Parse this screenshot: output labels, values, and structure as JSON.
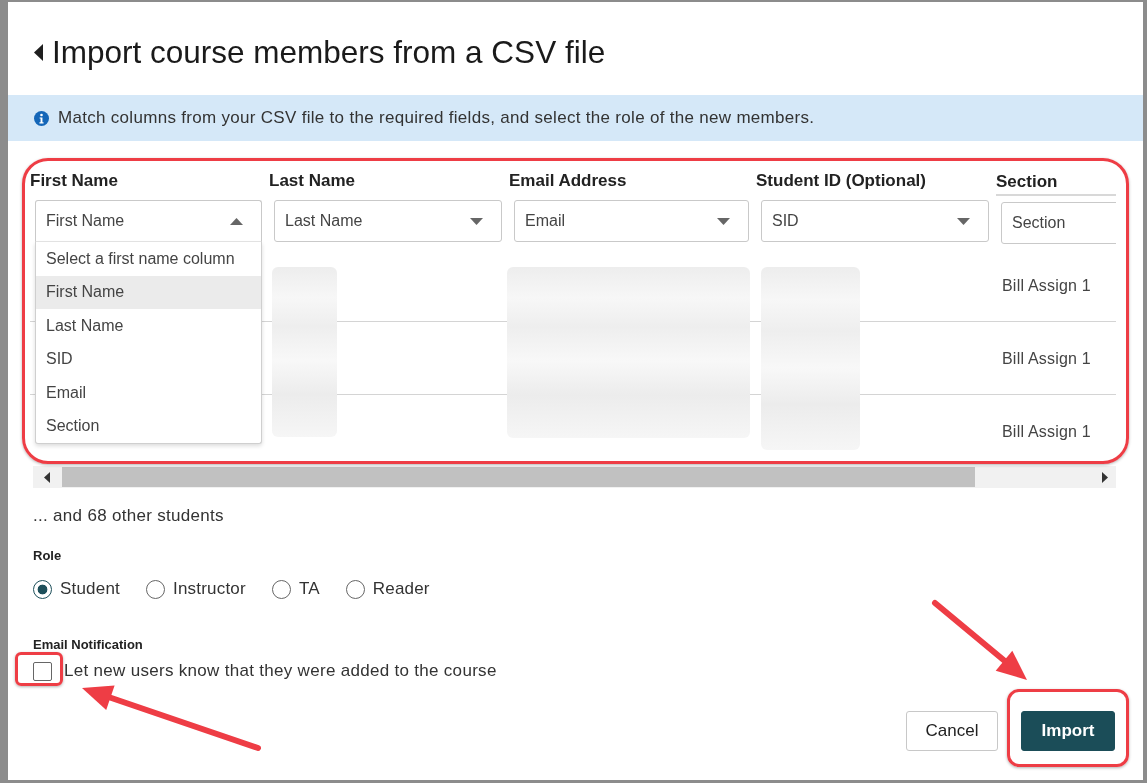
{
  "dialog": {
    "title": "Import course members from a CSV file"
  },
  "info_banner": {
    "text": "Match columns from your CSV file to the required fields, and select the role of the new members."
  },
  "mapping_table": {
    "columns": [
      {
        "header": "First Name",
        "select": {
          "value": "First Name",
          "expanded": true,
          "options": [
            {
              "label": "Select a first name column",
              "selected": false
            },
            {
              "label": "First Name",
              "selected": true
            },
            {
              "label": "Last Name",
              "selected": false
            },
            {
              "label": "SID",
              "selected": false
            },
            {
              "label": "Email",
              "selected": false
            },
            {
              "label": "Section",
              "selected": false
            }
          ]
        }
      },
      {
        "header": "Last Name",
        "select": {
          "value": "Last Name",
          "expanded": false
        }
      },
      {
        "header": "Email Address",
        "select": {
          "value": "Email",
          "expanded": false
        }
      },
      {
        "header": "Student ID (Optional)",
        "select": {
          "value": "SID",
          "expanded": false
        }
      },
      {
        "header": "Section",
        "select": {
          "value": "Section"
        }
      }
    ],
    "rows": [
      {
        "section": "Bill Assign 1"
      },
      {
        "section": "Bill Assign 1"
      },
      {
        "section": "Bill Assign 1"
      }
    ]
  },
  "more_students": "... and 68 other students",
  "role": {
    "label": "Role",
    "options": [
      {
        "label": "Student",
        "selected": true
      },
      {
        "label": "Instructor",
        "selected": false
      },
      {
        "label": "TA",
        "selected": false
      },
      {
        "label": "Reader",
        "selected": false
      }
    ]
  },
  "email_notification": {
    "label": "Email Notification",
    "checkbox": {
      "label": "Let new users know that they were added to the course",
      "checked": false
    }
  },
  "buttons": [
    {
      "label": "Cancel",
      "kind": "secondary"
    },
    {
      "label": "Import",
      "kind": "primary"
    }
  ]
}
